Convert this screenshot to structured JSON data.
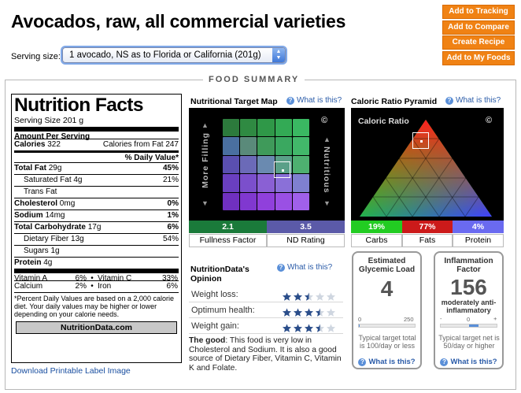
{
  "page": {
    "title": "Avocados, raw, all commercial varieties",
    "serving_label": "Serving size:",
    "serving_value": "1 avocado, NS as to Florida or California (201g)"
  },
  "actions": [
    {
      "label": "Add to Tracking"
    },
    {
      "label": "Add to Compare"
    },
    {
      "label": "Create Recipe"
    },
    {
      "label": "Add to My Foods"
    }
  ],
  "summary_title": "FOOD SUMMARY",
  "nutrition_facts": {
    "heading": "Nutrition Facts",
    "serving_size_label": "Serving Size",
    "serving_size_value": "201 g",
    "amount_per_serving": "Amount Per Serving",
    "calories_label": "Calories",
    "calories_value": "322",
    "calories_fat_label": "Calories from Fat",
    "calories_fat_value": "247",
    "daily_value_header": "% Daily Value*",
    "rows": [
      {
        "label": "Total Fat",
        "amount": "29g",
        "dv": "45%",
        "bold": true,
        "indent": false
      },
      {
        "label": "Saturated Fat",
        "amount": "4g",
        "dv": "21%",
        "bold": false,
        "indent": true
      },
      {
        "label": "Trans Fat",
        "amount": "",
        "dv": "",
        "bold": false,
        "indent": true
      },
      {
        "label": "Cholesterol",
        "amount": "0mg",
        "dv": "0%",
        "bold": true,
        "indent": false
      },
      {
        "label": "Sodium",
        "amount": "14mg",
        "dv": "1%",
        "bold": true,
        "indent": false
      },
      {
        "label": "Total Carbohydrate",
        "amount": "17g",
        "dv": "6%",
        "bold": true,
        "indent": false
      },
      {
        "label": "Dietary Fiber",
        "amount": "13g",
        "dv": "54%",
        "bold": false,
        "indent": true
      },
      {
        "label": "Sugars",
        "amount": "1g",
        "dv": "",
        "bold": false,
        "indent": true
      },
      {
        "label": "Protein",
        "amount": "4g",
        "dv": "",
        "bold": true,
        "indent": false
      }
    ],
    "vitamins": [
      {
        "left_label": "Vitamin A",
        "left_value": "6%",
        "right_label": "Vitamin C",
        "right_value": "33%"
      },
      {
        "left_label": "Calcium",
        "left_value": "2%",
        "right_label": "Iron",
        "right_value": "6%"
      }
    ],
    "footnote": "*Percent Daily Values are based on a 2,000 calorie diet. Your daily values may be higher or lower depending on your calorie needs.",
    "brand": "NutritionData.com"
  },
  "download_link": "Download Printable Label Image",
  "target_map": {
    "title": "Nutritional Target Map",
    "what_link": "What is this?",
    "left_axis": "More Filling",
    "right_axis": "Nutritious",
    "copyright": "©",
    "fullness_value": "2.1",
    "fullness_label": "Fullness Factor",
    "nd_value": "3.5",
    "nd_label": "ND Rating"
  },
  "pyramid": {
    "title": "Caloric Ratio Pyramid",
    "what_link": "What is this?",
    "inner_label": "Caloric Ratio",
    "copyright": "©",
    "carbs_pct": "19%",
    "carbs_label": "Carbs",
    "fats_pct": "77%",
    "fats_label": "Fats",
    "protein_pct": "4%",
    "protein_label": "Protein"
  },
  "opinion": {
    "title_line1": "NutritionData's",
    "title_line2": "Opinion",
    "what_link": "What is this?",
    "rows": [
      {
        "label": "Weight loss:",
        "stars": 2.5
      },
      {
        "label": "Optimum health:",
        "stars": 3.5
      },
      {
        "label": "Weight gain:",
        "stars": 3.5
      }
    ],
    "good_label": "The good",
    "good_text": ": This food is very low in Cholesterol and Sodium. It is also a good source of Dietary Fiber, Vitamin C, Vitamin K and Folate."
  },
  "glycemic": {
    "title": "Estimated Glycemic Load",
    "value": "4",
    "scale_min": "0",
    "scale_max": "250",
    "fill_fraction": 0.016,
    "note": "Typical target total is 100/day or less",
    "what_link": "What is this?"
  },
  "inflammation": {
    "title": "Inflammation Factor",
    "value": "156",
    "subtitle": "moderately anti-inflammatory",
    "scale_minus": "-",
    "scale_zero": "0",
    "scale_plus": "+",
    "note": "Typical target net is 50/day or higher",
    "what_link": "What is this?"
  },
  "colors": {
    "action_orange": "#f08214",
    "link_blue": "#2a5ba8",
    "fullness_green": "#1a7a3a",
    "nd_purple": "#5b5aa8",
    "carbs_green": "#22cc22",
    "fats_red": "#cc1a1a",
    "protein_blue": "#6a6af0"
  }
}
